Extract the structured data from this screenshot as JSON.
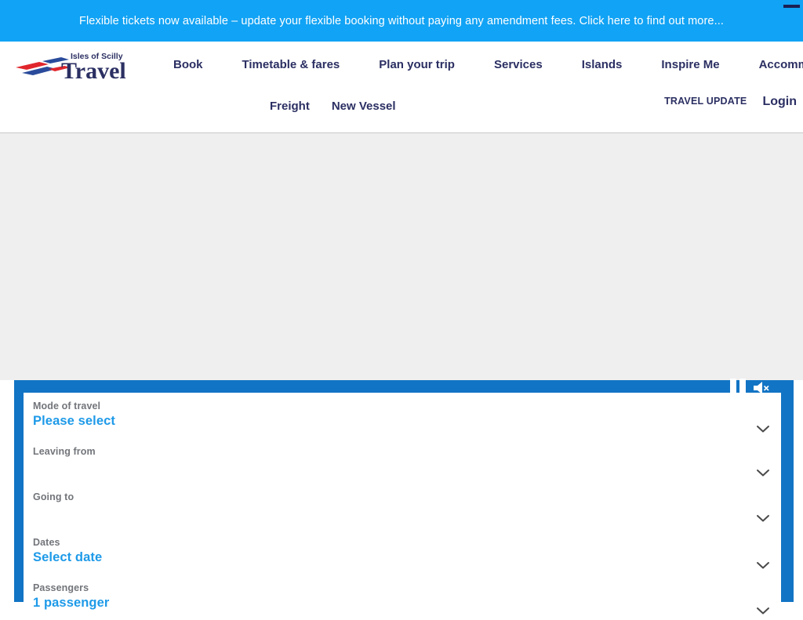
{
  "promo": {
    "text": "Flexible tickets now available – update your flexible booking without paying any amendment fees. Click here to find out more...",
    "close_icon": "minus-icon",
    "background": "#11a3f5"
  },
  "brand": {
    "tagline": "Isles of Scilly",
    "name": "Travel",
    "navy": "#2b2f62",
    "red": "#e0262c",
    "blue": "#2a4b9b"
  },
  "nav": {
    "primary": [
      {
        "label": "Book"
      },
      {
        "label": "Timetable & fares"
      },
      {
        "label": "Plan your trip"
      },
      {
        "label": "Services"
      },
      {
        "label": "Islands"
      },
      {
        "label": "Inspire Me"
      },
      {
        "label": "Accommodation"
      }
    ],
    "secondary": [
      {
        "label": "Freight"
      },
      {
        "label": "New Vessel"
      }
    ],
    "travel_update": "TRAVEL UPDATE",
    "login": "Login"
  },
  "hero": {
    "background": "#efefef",
    "controls": [
      {
        "icon": "pause-icon",
        "label": "Pause"
      },
      {
        "icon": "mute-icon",
        "label": "Mute"
      }
    ]
  },
  "booking": {
    "accent": "#1274c4",
    "fields": [
      {
        "label": "Mode of travel",
        "value": "Please select",
        "icon": "chevron-down-icon"
      },
      {
        "label": "Leaving from",
        "value": "",
        "icon": "chevron-down-icon"
      },
      {
        "label": "Going to",
        "value": "",
        "icon": "chevron-down-icon"
      },
      {
        "label": "Dates",
        "value": "Select date",
        "icon": "chevron-down-icon"
      },
      {
        "label": "Passengers",
        "value": "1 passenger",
        "icon": "chevron-down-icon"
      }
    ]
  }
}
